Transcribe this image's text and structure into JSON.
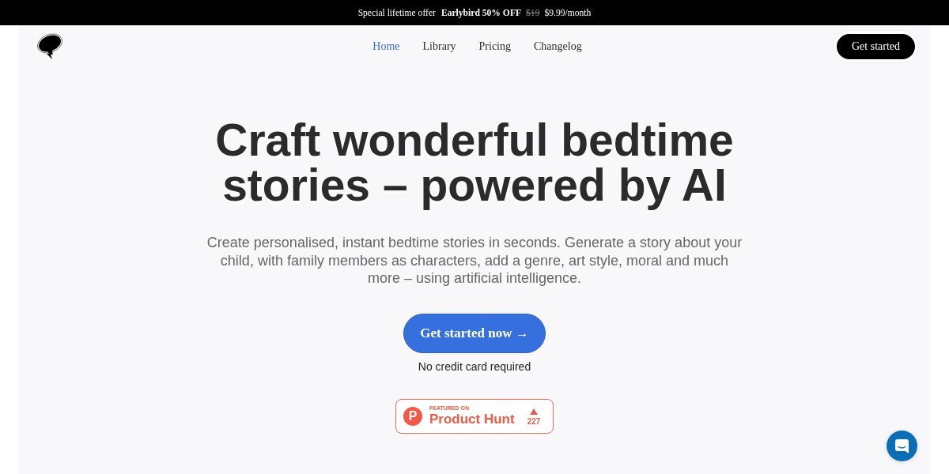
{
  "promo_bar": {
    "label": "Special lifetime offer",
    "highlight": "Earlybird 50% OFF",
    "old_price": "$19",
    "price": "$9.99/month"
  },
  "header": {
    "nav": [
      {
        "label": "Home",
        "selected": true
      },
      {
        "label": "Library",
        "selected": false
      },
      {
        "label": "Pricing",
        "selected": false
      },
      {
        "label": "Changelog",
        "selected": false
      }
    ],
    "cta": "Get started"
  },
  "hero": {
    "title": "Craft wonderful bedtime stories – powered by AI",
    "subtitle": "Create personalised, instant bedtime stories in seconds. Generate a story about your child, with family members as characters, add a genre, art style, moral and much more – using artificial intelligence.",
    "cta": "Get started now →",
    "note": "No credit card required"
  },
  "product_hunt_badge": {
    "logo_letter": "P",
    "eyebrow": "FEATURED ON",
    "name": "Product Hunt",
    "votes": "227"
  }
}
